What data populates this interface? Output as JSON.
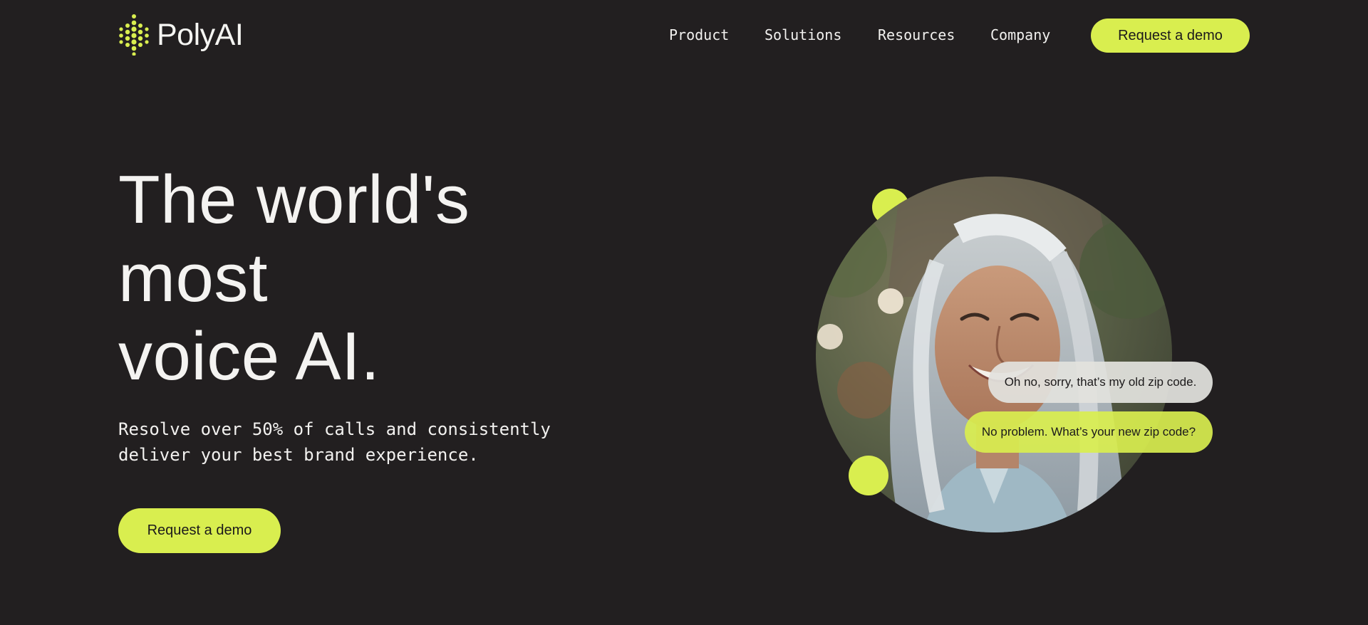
{
  "brand": {
    "name": "PolyAI",
    "accent": "#d9ee4f",
    "background": "#221f20",
    "logo_icon": "dot-grid-logo-icon"
  },
  "nav": {
    "items": [
      {
        "label": "Product"
      },
      {
        "label": "Solutions"
      },
      {
        "label": "Resources"
      },
      {
        "label": "Company"
      }
    ],
    "cta_label": "Request a demo"
  },
  "hero": {
    "title_lines": [
      "The world's",
      "most",
      "voice AI."
    ],
    "subtitle_lines": [
      "Resolve over 50% of calls and consistently",
      "deliver your best brand experience."
    ],
    "cta_label": "Request a demo"
  },
  "conversation": {
    "user_message": "Oh no, sorry, that’s my old zip code.",
    "ai_message": "No problem. What’s your new zip code?"
  }
}
